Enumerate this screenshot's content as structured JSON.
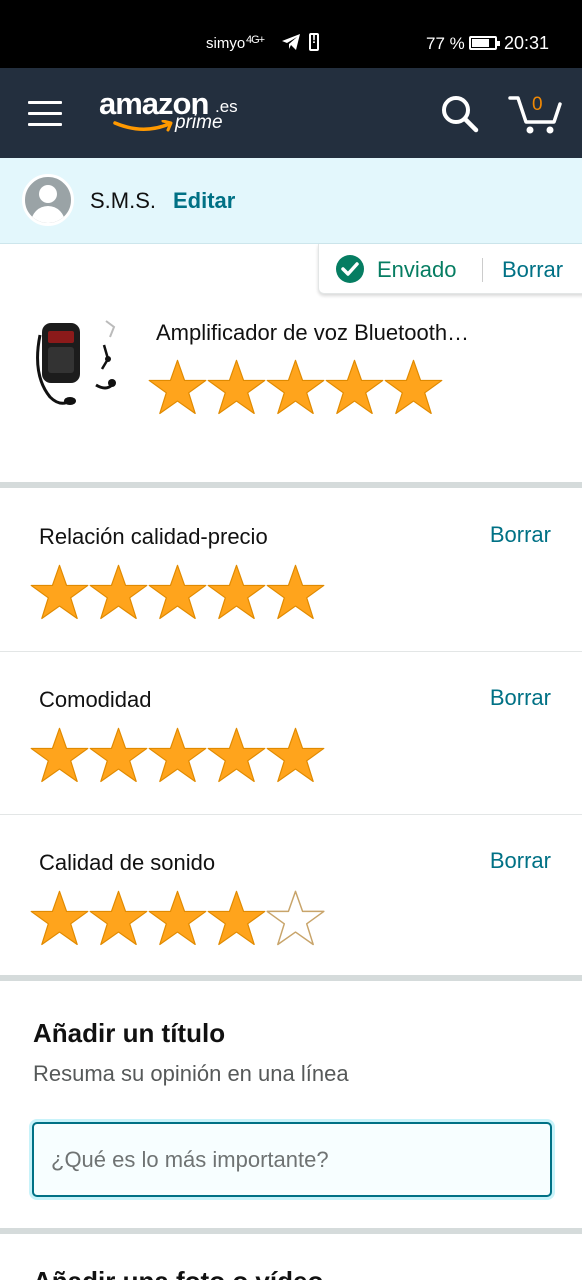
{
  "status_bar": {
    "carrier": "simyo",
    "network": "4G+",
    "battery_percent": "77 %",
    "battery_level": 0.77,
    "time": "20:31",
    "icons": [
      "signal-icon",
      "telegram-icon",
      "battery-alert-icon",
      "battery-icon"
    ]
  },
  "header": {
    "logo_text": "amazon",
    "logo_domain": ".es",
    "logo_prime": "prime",
    "cart_count": "0",
    "colors": {
      "background": "#232f3e",
      "cart_count": "#f08804"
    }
  },
  "user": {
    "name": "S.M.S.",
    "edit_label": "Editar"
  },
  "status_pill": {
    "sent_label": "Enviado",
    "delete_label": "Borrar"
  },
  "product": {
    "title": "Amplificador de voz Bluetooth…",
    "rating": 5,
    "max_rating": 5
  },
  "ratings": [
    {
      "label": "Relación calidad-precio",
      "delete_label": "Borrar",
      "value": 5
    },
    {
      "label": "Comodidad",
      "delete_label": "Borrar",
      "value": 5
    },
    {
      "label": "Calidad de sonido",
      "delete_label": "Borrar",
      "value": 4
    }
  ],
  "title_section": {
    "heading": "Añadir un título",
    "subheading": "Resuma su opinión en una línea",
    "input_placeholder": "¿Qué es lo más importante?",
    "input_value": ""
  },
  "next_section": {
    "heading": "Añadir una foto o vídeo"
  },
  "colors": {
    "link": "#007185",
    "success": "#067d62",
    "star_fill": "#ffa41c",
    "star_empty_stroke": "#c8a46a",
    "user_bar_bg": "#e3f7fc"
  }
}
